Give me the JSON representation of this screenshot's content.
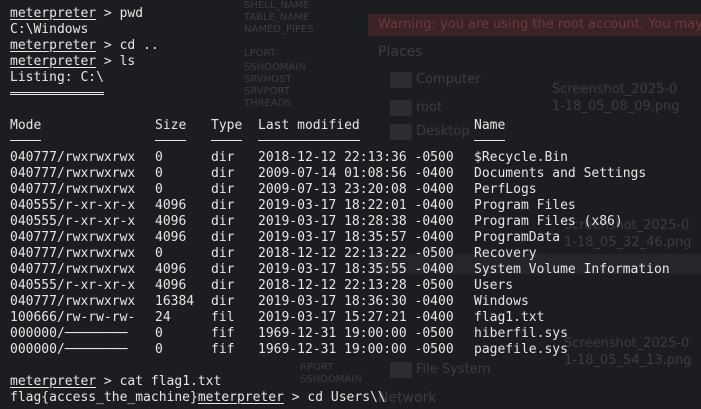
{
  "ghost": {
    "banner": "Warning: you are using the root account. You may",
    "places_label": "Places",
    "places": [
      "Computer",
      "root",
      "Desktop",
      "File System"
    ],
    "network_label": "Network",
    "thumbs": [
      "Screenshot_2025-0",
      "1-18_05_08_09.png",
      "Screenshot_2025-0",
      "1-18_05_32_46.png",
      "Screenshot_2025-0",
      "1-18_05_54_13.png"
    ],
    "lines": [
      "SHELL_NAME",
      "TABLE_NAME",
      "NAMED_PIPES",
      "LPORT",
      "SSHDOMAIN",
      "SRVHOST",
      "SRVPORT",
      "THREADS",
      "RPORT",
      "SSHDOMAIN"
    ]
  },
  "terminal": {
    "prompt": "meterpreter",
    "prompt_sep": " > ",
    "lines": [
      {
        "type": "cmd",
        "cmd": "pwd"
      },
      {
        "type": "out",
        "text": "C:\\Windows"
      },
      {
        "type": "cmd",
        "cmd": "cd .."
      },
      {
        "type": "cmd",
        "cmd": "ls"
      },
      {
        "type": "out",
        "text": "Listing: C:\\"
      }
    ],
    "headers": {
      "mode": "Mode",
      "size": "Size",
      "type": "Type",
      "modified": "Last modified",
      "name": "Name"
    },
    "rows": [
      [
        "040777/rwxrwxrwx",
        "0",
        "dir",
        "2018-12-12 22:13:36 -0500",
        "$Recycle.Bin"
      ],
      [
        "040777/rwxrwxrwx",
        "0",
        "dir",
        "2009-07-14 01:08:56 -0400",
        "Documents and Settings"
      ],
      [
        "040777/rwxrwxrwx",
        "0",
        "dir",
        "2009-07-13 23:20:08 -0400",
        "PerfLogs"
      ],
      [
        "040555/r-xr-xr-x",
        "4096",
        "dir",
        "2019-03-17 18:22:01 -0400",
        "Program Files"
      ],
      [
        "040555/r-xr-xr-x",
        "4096",
        "dir",
        "2019-03-17 18:28:38 -0400",
        "Program Files (x86)"
      ],
      [
        "040777/rwxrwxrwx",
        "4096",
        "dir",
        "2019-03-17 18:35:57 -0400",
        "ProgramData"
      ],
      [
        "040777/rwxrwxrwx",
        "0",
        "dir",
        "2018-12-12 22:13:22 -0500",
        "Recovery"
      ],
      [
        "040777/rwxrwxrwx",
        "4096",
        "dir",
        "2019-03-17 18:35:55 -0400",
        "System Volume Information"
      ],
      [
        "040555/r-xr-xr-x",
        "4096",
        "dir",
        "2018-12-12 22:13:28 -0500",
        "Users"
      ],
      [
        "040777/rwxrwxrwx",
        "16384",
        "dir",
        "2019-03-17 18:36:30 -0400",
        "Windows"
      ],
      [
        "100666/rw-rw-rw-",
        "24",
        "fil",
        "2019-03-17 15:27:21 -0400",
        "flag1.txt"
      ],
      [
        "000000/────────",
        "0",
        "fif",
        "1969-12-31 19:00:00 -0500",
        "hiberfil.sys"
      ],
      [
        "000000/────────",
        "0",
        "fif",
        "1969-12-31 19:00:00 -0500",
        "pagefile.sys"
      ]
    ],
    "cmd_cat": "cat flag1.txt",
    "flag_output": "flag{access_the_machine}",
    "cmd_cd": "cd Users\\\\"
  }
}
